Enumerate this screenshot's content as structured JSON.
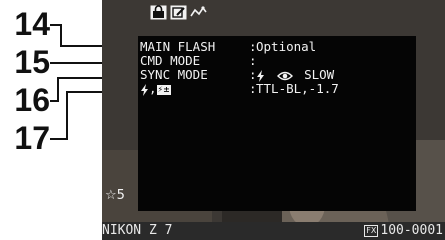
{
  "callouts": [
    {
      "number": "14"
    },
    {
      "number": "15"
    },
    {
      "number": "16"
    },
    {
      "number": "17"
    }
  ],
  "top_icons": [
    "lock-icon",
    "edit-icon",
    "network-icon"
  ],
  "flash_info": {
    "rows": [
      {
        "label": "MAIN FLASH",
        "separator": ":",
        "value": "Optional"
      },
      {
        "label": "CMD MODE",
        "separator": ":",
        "value": ""
      },
      {
        "label": "SYNC MODE",
        "separator": ":",
        "value": "SLOW",
        "icons": [
          "flash-icon",
          "red-eye-icon"
        ]
      },
      {
        "label": ",",
        "separator": ":",
        "value": "TTL-BL,-1.7",
        "icons": [
          "flash-icon",
          "flash-comp-icon"
        ]
      }
    ]
  },
  "rating": {
    "value": "5",
    "icon": "star-outline-icon"
  },
  "footer": {
    "model": "NIKON Z 7",
    "format_badge": "FX",
    "file_number": "100-0001"
  },
  "colors": {
    "panel": "#050505",
    "text": "#f2f2f2",
    "photo_background": "#3c3834",
    "callout": "#111111"
  }
}
